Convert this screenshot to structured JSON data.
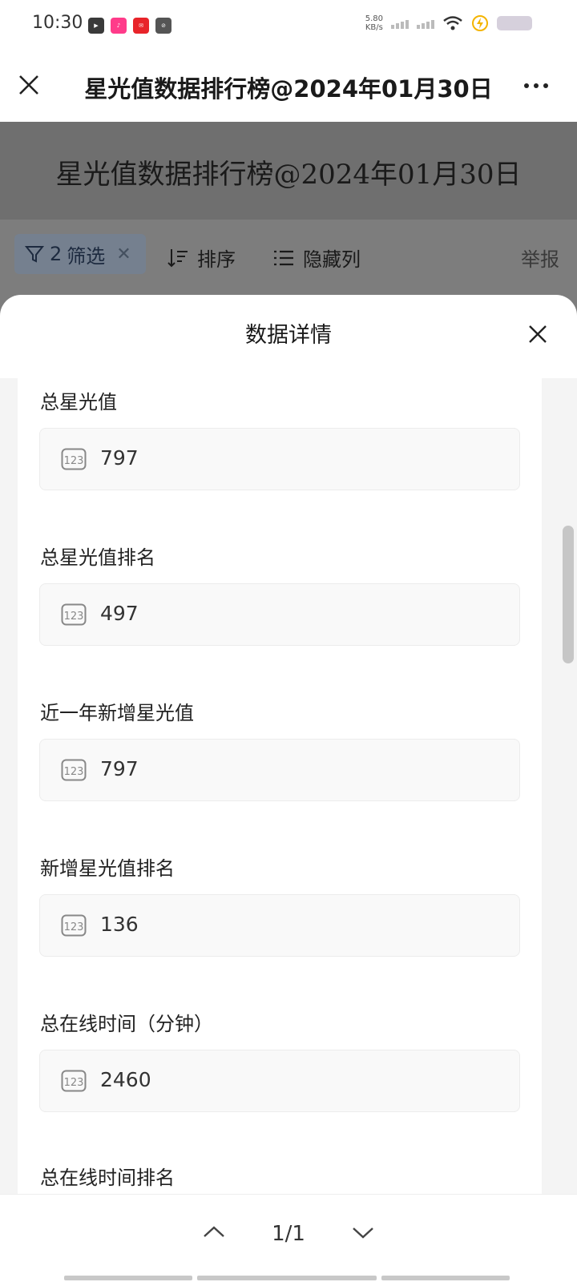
{
  "status_bar": {
    "time": "10:30",
    "net_speed": "5.80",
    "net_unit": "KB/s",
    "apps": [
      {
        "icon": "video-app-icon",
        "color": "#3a3a3a",
        "label": ""
      },
      {
        "icon": "music-app-icon",
        "color": "#ff3b8a",
        "label": ""
      },
      {
        "icon": "news-app-icon",
        "color": "#e8242a",
        "label": ""
      },
      {
        "icon": "link-app-icon",
        "color": "#555555",
        "label": ""
      }
    ]
  },
  "header": {
    "title": "星光值数据排行榜@2024年01月30日"
  },
  "page": {
    "title": "星光值数据排行榜@2024年01月30日",
    "filter_count": "2",
    "filter_label": "筛选",
    "sort_label": "排序",
    "hide_columns_label": "隐藏列",
    "report_label": "举报"
  },
  "sheet": {
    "title": "数据详情",
    "fields": [
      {
        "label": "总星光值",
        "value": "797"
      },
      {
        "label": "总星光值排名",
        "value": "497"
      },
      {
        "label": "近一年新增星光值",
        "value": "797"
      },
      {
        "label": "新增星光值排名",
        "value": "136"
      },
      {
        "label": "总在线时间（分钟）",
        "value": "2460"
      },
      {
        "label": "总在线时间排名",
        "value": ""
      }
    ]
  },
  "pager": {
    "text": "1/1"
  },
  "colors": {
    "overlay": "#7d7d7d",
    "field_bg": "#f9f9f9",
    "accent_chip": "#75808f"
  }
}
